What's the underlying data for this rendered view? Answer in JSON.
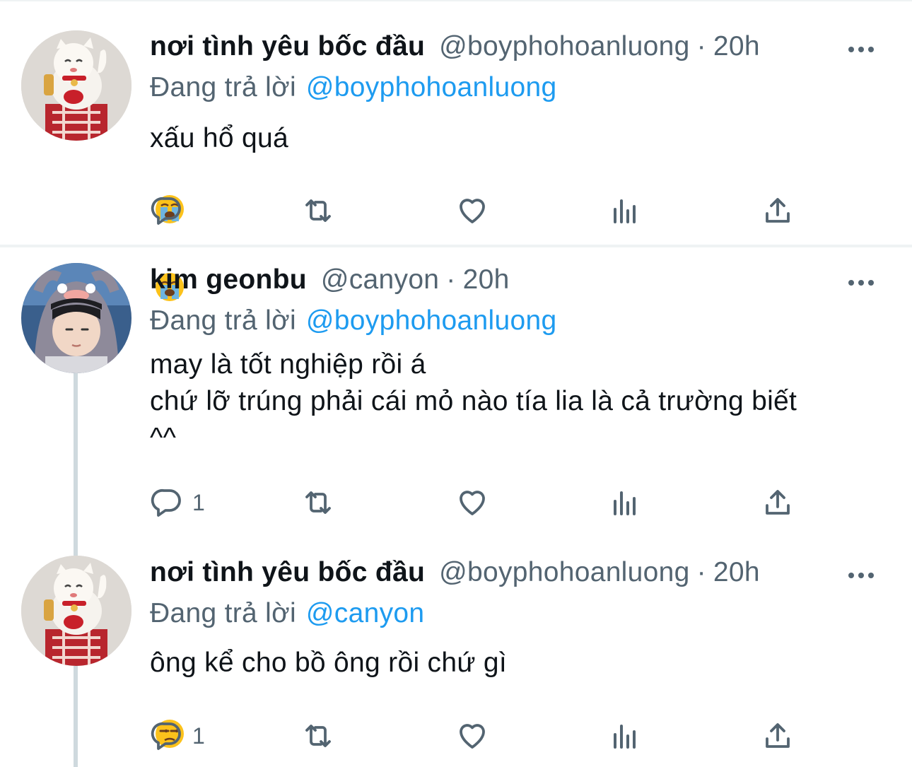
{
  "tweets": [
    {
      "avatar_icon": "lucky-cat-avatar",
      "name": "nơi tình yêu bốc đầu",
      "handle": "@boyphohoanluong",
      "dot": "·",
      "time": "20h",
      "reply_prefix": "Đang trả lời",
      "reply_to": "@boyphohoanluong",
      "text": "xấu hổ quá",
      "emojis": [
        "loudly-crying-face",
        "loudly-crying-face"
      ],
      "reply_count": "",
      "icons": [
        "reply-icon",
        "retweet-icon",
        "like-icon",
        "analytics-icon",
        "share-icon"
      ]
    },
    {
      "avatar_icon": "person-hat-avatar",
      "name": "kim geonbu",
      "handle": "@canyon",
      "dot": "·",
      "time": "20h",
      "reply_prefix": "Đang trả lời",
      "reply_to": "@boyphohoanluong",
      "text": "may là tốt nghiệp rồi á\nchứ lỡ trúng phải cái mỏ nào tía lia là cả trường biết\n^^",
      "emojis": [],
      "reply_count": "1",
      "icons": [
        "reply-icon",
        "retweet-icon",
        "like-icon",
        "analytics-icon",
        "share-icon"
      ]
    },
    {
      "avatar_icon": "lucky-cat-avatar",
      "name": "nơi tình yêu bốc đầu",
      "handle": "@boyphohoanluong",
      "dot": "·",
      "time": "20h",
      "reply_prefix": "Đang trả lời",
      "reply_to": "@canyon",
      "text": "ông kể cho bồ ông rồi chứ gì",
      "emojis": [
        "unamused-face"
      ],
      "reply_count": "1",
      "icons": [
        "reply-icon",
        "retweet-icon",
        "like-icon",
        "analytics-icon",
        "share-icon"
      ]
    }
  ],
  "colors": {
    "text": "#0f1419",
    "secondary": "#536471",
    "link": "#1d9bf0",
    "divider": "#eff3f4",
    "thread_line": "#cfd9de"
  }
}
